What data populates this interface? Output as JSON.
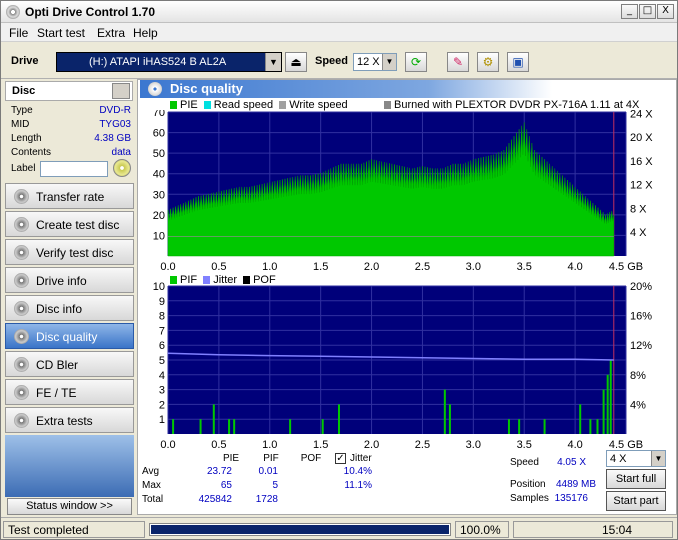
{
  "window": {
    "title": "Opti Drive Control 1.70"
  },
  "titlebar": {
    "minimize": "_",
    "maximize": "□",
    "close": "X"
  },
  "menu": [
    "File",
    "Start test",
    "Extra",
    "Help"
  ],
  "toolbar": {
    "drive_label": "Drive",
    "drive_value": "(H:)   ATAPI iHAS524   B AL2A",
    "speed_label": "Speed",
    "speed_value": "12 X"
  },
  "disc": {
    "header": "Disc",
    "rows": [
      {
        "k": "Type",
        "v": "DVD-R"
      },
      {
        "k": "MID",
        "v": "TYG03"
      },
      {
        "k": "Length",
        "v": "4.38 GB"
      },
      {
        "k": "Contents",
        "v": "data"
      }
    ],
    "label_caption": "Label"
  },
  "nav": [
    "Transfer rate",
    "Create test disc",
    "Verify test disc",
    "Drive info",
    "Disc info",
    "Disc quality",
    "CD Bler",
    "FE / TE",
    "Extra tests"
  ],
  "nav_active_index": 5,
  "status_window_label": "Status window >>",
  "panel": {
    "title": "Disc quality"
  },
  "top_legend": {
    "pie": "PIE",
    "read": "Read speed",
    "write": "Write speed",
    "burned": "Burned with PLEXTOR DVDR   PX-716A 1.11 at 4X"
  },
  "bottom_legend": {
    "pif": "PIF",
    "jitter": "Jitter",
    "pof": "POF"
  },
  "colors": {
    "pie": "#00c800",
    "read": "#00e0e0",
    "write": "#a0a0a0",
    "pif": "#00c800",
    "jitter": "#8080ff",
    "pof": "#000000",
    "chart_bg": "#00007a",
    "grid": "#3030a0"
  },
  "chart_data": [
    {
      "type": "area",
      "x_ticks": [
        "0.0",
        "0.5",
        "1.0",
        "1.5",
        "2.0",
        "2.5",
        "3.0",
        "3.5",
        "4.0",
        "4.5 GB"
      ],
      "y_ticks_left": [
        "10",
        "20",
        "30",
        "40",
        "50",
        "60",
        "70"
      ],
      "y_ticks_right": [
        "4 X",
        "8 X",
        "12 X",
        "16 X",
        "20 X",
        "24 X"
      ],
      "xlim": [
        0,
        4.5
      ],
      "ylim": [
        0,
        70
      ],
      "series": [
        {
          "name": "PIE",
          "x": [
            0.0,
            0.1,
            0.2,
            0.3,
            0.4,
            0.5,
            0.6,
            0.7,
            0.8,
            0.9,
            1.0,
            1.1,
            1.2,
            1.3,
            1.4,
            1.5,
            1.6,
            1.7,
            1.8,
            1.9,
            2.0,
            2.1,
            2.2,
            2.3,
            2.4,
            2.5,
            2.6,
            2.7,
            2.8,
            2.9,
            3.0,
            3.1,
            3.2,
            3.3,
            3.4,
            3.5,
            3.6,
            3.7,
            3.8,
            3.9,
            4.0,
            4.1,
            4.2,
            4.3,
            4.38
          ],
          "values": [
            20,
            22,
            24,
            26,
            27,
            28,
            29,
            30,
            30,
            31,
            32,
            33,
            34,
            35,
            35,
            36,
            38,
            40,
            40,
            40,
            42,
            41,
            40,
            39,
            38,
            39,
            38,
            38,
            40,
            40,
            42,
            43,
            44,
            46,
            52,
            58,
            46,
            42,
            38,
            34,
            30,
            26,
            22,
            18,
            20
          ]
        }
      ]
    },
    {
      "type": "bar",
      "x_ticks": [
        "0.0",
        "0.5",
        "1.0",
        "1.5",
        "2.0",
        "2.5",
        "3.0",
        "3.5",
        "4.0",
        "4.5 GB"
      ],
      "y_ticks_left": [
        "1",
        "2",
        "3",
        "4",
        "5",
        "6",
        "7",
        "8",
        "9",
        "10"
      ],
      "y_ticks_right": [
        "4%",
        "8%",
        "12%",
        "16%",
        "20%"
      ],
      "xlim": [
        0,
        4.5
      ],
      "ylim": [
        0,
        10
      ],
      "series": [
        {
          "name": "PIF",
          "x": [
            0.05,
            0.32,
            0.45,
            0.6,
            0.65,
            1.2,
            1.52,
            1.68,
            2.72,
            2.77,
            3.35,
            3.45,
            3.7,
            4.05,
            4.15,
            4.22,
            4.28,
            4.32,
            4.35
          ],
          "values": [
            1,
            1,
            2,
            1,
            1,
            1,
            1,
            2,
            3,
            2,
            1,
            1,
            1,
            2,
            1,
            1,
            3,
            4,
            5
          ]
        },
        {
          "name": "Jitter",
          "x": [
            0.0,
            0.5,
            1.0,
            1.5,
            2.0,
            2.5,
            3.0,
            3.5,
            4.0,
            4.38
          ],
          "values": [
            10.9,
            10.7,
            10.6,
            10.5,
            10.4,
            10.3,
            10.2,
            10.1,
            10.1,
            10.0
          ]
        }
      ]
    }
  ],
  "stats": {
    "headers": {
      "pie": "PIE",
      "pif": "PIF",
      "pof": "POF",
      "jitter": "Jitter"
    },
    "avg": {
      "label": "Avg",
      "pie": "23.72",
      "pif": "0.01",
      "jitter": "10.4%"
    },
    "max": {
      "label": "Max",
      "pie": "65",
      "pif": "5",
      "jitter": "11.1%"
    },
    "total": {
      "label": "Total",
      "pie": "425842",
      "pif": "1728"
    },
    "speed_label": "Speed",
    "speed_value": "4.05 X",
    "position_label": "Position",
    "position_value": "4489 MB",
    "samples_label": "Samples",
    "samples_value": "135176",
    "speed_select": "4 X",
    "start_full": "Start full",
    "start_part": "Start part"
  },
  "statusbar": {
    "text": "Test completed",
    "progress": 100,
    "progress_text": "100.0%",
    "time": "15:04"
  }
}
